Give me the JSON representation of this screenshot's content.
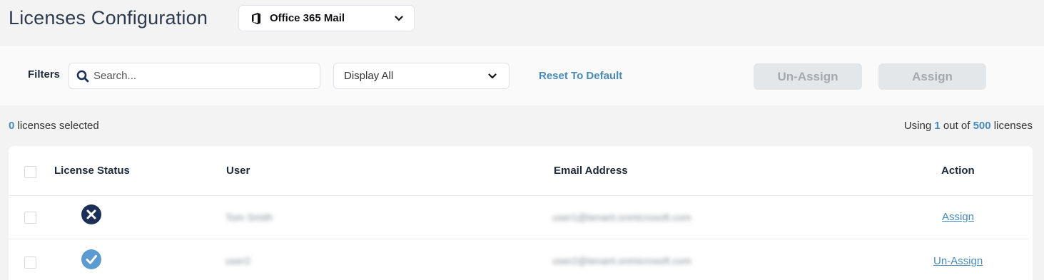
{
  "header": {
    "title": "Licenses Configuration",
    "product_select": {
      "value": "Office 365 Mail",
      "icon": "office-icon"
    }
  },
  "filters": {
    "label": "Filters",
    "search_placeholder": "Search...",
    "display_select": "Display All",
    "reset_label": "Reset To Default",
    "unassign_label": "Un-Assign",
    "assign_label": "Assign"
  },
  "summary": {
    "selected_count": "0",
    "selected_text": "licenses selected",
    "using_prefix": "Using",
    "used": "1",
    "out_of": "out of",
    "total": "500",
    "suffix": "licenses"
  },
  "table": {
    "columns": [
      "License Status",
      "User",
      "Email Address",
      "Action"
    ],
    "rows": [
      {
        "status": "unassigned",
        "status_icon": "x-circle-icon",
        "user": "Tom Smith",
        "email": "user1@tenant.onmicrosoft.com",
        "action": "Assign"
      },
      {
        "status": "assigned",
        "status_icon": "check-circle-icon",
        "user": "user2",
        "email": "user2@tenant.onmicrosoft.com",
        "action": "Un-Assign"
      }
    ]
  },
  "colors": {
    "accent": "#4a8ab8",
    "navy": "#1b2f57",
    "check_blue": "#5b9bd0",
    "disabled_bg": "#e4e7ea",
    "disabled_text": "#a3a9b1"
  }
}
